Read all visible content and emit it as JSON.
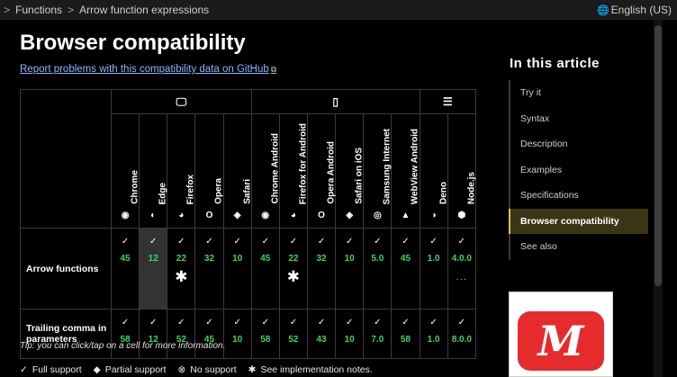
{
  "breadcrumb": {
    "items": [
      "Functions",
      "Arrow function expressions"
    ],
    "separator": ">"
  },
  "lang": {
    "label": "English (US)"
  },
  "page": {
    "title": "Browser compatibility",
    "report_link": "Report problems with this compatibility data on GitHub",
    "tip": "Tip: you can click/tap on a cell for more information."
  },
  "table": {
    "platforms": [
      {
        "name": "desktop",
        "icon": "desktop-icon",
        "glyph": "🖵"
      },
      {
        "name": "mobile",
        "icon": "mobile-icon",
        "glyph": "▯"
      },
      {
        "name": "server",
        "icon": "server-icon",
        "glyph": "☰"
      }
    ],
    "browsers": [
      "Chrome",
      "Edge",
      "Firefox",
      "Opera",
      "Safari",
      "Chrome Android",
      "Firefox for Android",
      "Opera Android",
      "Safari on iOS",
      "Samsung Internet",
      "WebView Android",
      "Deno",
      "Node.js"
    ],
    "rows": [
      {
        "feature": "Arrow functions",
        "versions": [
          "45",
          "12",
          "22",
          "32",
          "10",
          "45",
          "22",
          "32",
          "10",
          "5.0",
          "45",
          "1.0",
          "4.0.0"
        ]
      },
      {
        "feature": "Trailing comma in parameters",
        "versions": [
          "58",
          "12",
          "52",
          "45",
          "10",
          "58",
          "52",
          "43",
          "10",
          "7.0",
          "58",
          "1.0",
          "8.0.0"
        ]
      }
    ],
    "note_marker": "✱",
    "more_marker": "···"
  },
  "legend": {
    "full": "Full support",
    "partial": "Partial support",
    "none": "No support",
    "notes": "See implementation notes."
  },
  "sidebar": {
    "title": "In this article",
    "items": [
      "Try it",
      "Syntax",
      "Description",
      "Examples",
      "Specifications",
      "Browser compatibility",
      "See also"
    ]
  },
  "colors": {
    "support_green": "#3ed65d",
    "active_accent": "#e0c04a",
    "link": "#8cb4ff"
  }
}
